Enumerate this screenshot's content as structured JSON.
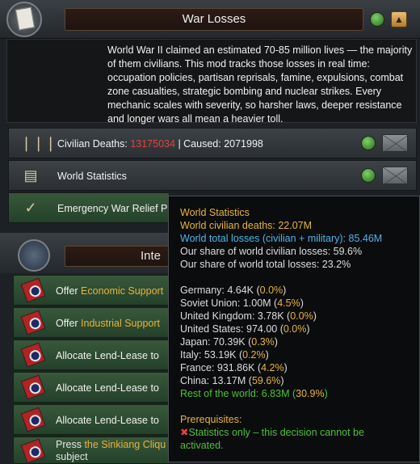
{
  "header": {
    "title": "War Losses",
    "icon": "war-document-icon"
  },
  "description": "World War II claimed an estimated 70-85 million lives — the majority of them civilians. This mod tracks those losses in real time: occupation policies, partisan reprisals, famine, expulsions, combat zone casualties, strategic bombing and nuclear strikes. Every mechanic scales with severity, so harsher laws, deeper resistance and longer wars all mean a heavier toll.",
  "rows": [
    {
      "icon": "ammunition-icon",
      "label": "Civilian Deaths:",
      "value_red": "13175034",
      "caused": "| Caused: 2071998"
    },
    {
      "icon": "documents-icon",
      "label": "World Statistics"
    },
    {
      "icon": "relief-icon",
      "label": "Emergency War Relief P"
    }
  ],
  "section2": {
    "title": "Inte"
  },
  "decisions": [
    {
      "prefix": "Offer ",
      "gold": "Economic Support",
      "suffix": ""
    },
    {
      "prefix": "Offer ",
      "gold": "Industrial Support",
      "suffix": ""
    },
    {
      "prefix": "Allocate Lend-Lease to",
      "gold": "",
      "suffix": ""
    },
    {
      "prefix": "Allocate Lend-Lease to",
      "gold": "",
      "suffix": ""
    },
    {
      "prefix": "Allocate Lend-Lease to",
      "gold": "",
      "suffix": ""
    },
    {
      "prefix": "Press ",
      "gold": "the Sinkiang Cliqu",
      "suffix": "",
      "line2": "subject"
    }
  ],
  "tooltip": {
    "title": "World Statistics",
    "civ_deaths": "World civilian deaths: 22.07M",
    "total_losses": "World total losses (civilian + military): 85.46M",
    "share_civ": "Our share of world civilian losses: 59.6%",
    "share_total": "Our share of world total losses: 23.2%",
    "countries": [
      {
        "name": "Germany: 4.64K (",
        "pct": "0.0%",
        "end": ")"
      },
      {
        "name": "Soviet Union: 1.00M (",
        "pct": "4.5%",
        "end": ")"
      },
      {
        "name": "United Kingdom: 3.78K (",
        "pct": "0.0%",
        "end": ")"
      },
      {
        "name": "United States: 974.00 (",
        "pct": "0.0%",
        "end": ")"
      },
      {
        "name": "Japan: 70.39K (",
        "pct": "0.3%",
        "end": ")"
      },
      {
        "name": "Italy: 53.19K (",
        "pct": "0.2%",
        "end": ")"
      },
      {
        "name": "France: 931.86K (",
        "pct": "4.2%",
        "end": ")"
      },
      {
        "name": "China: 13.17M (",
        "pct": "59.6%",
        "end": ")"
      }
    ],
    "rest": {
      "name": "Rest of the world: 6.83M (",
      "pct": "30.9%",
      "end": ")"
    },
    "prereq_title": "Prerequisites:",
    "prereq_line1": "Statistics only – this decision cannot be",
    "prereq_line2": "activated."
  },
  "colors": {
    "gold": "#e7b43b",
    "blue": "#4fb3e8",
    "green": "#4fbf3a",
    "red": "#e0443c"
  }
}
